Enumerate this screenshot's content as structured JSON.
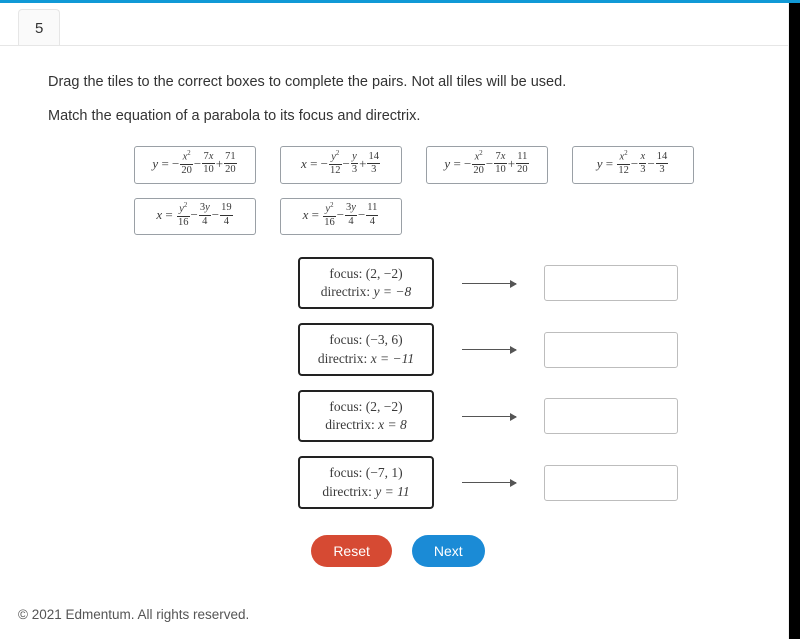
{
  "tab": {
    "label": "5"
  },
  "instruction": "Drag the tiles to the correct boxes to complete the pairs. Not all tiles will be used.",
  "subinstruction": "Match the equation of a parabola to its focus and directrix.",
  "tiles": {
    "t1": {
      "lhs_var": "y",
      "terms": [
        "−",
        "x²",
        "20",
        "−",
        "7x",
        "10",
        "+",
        "71",
        "20"
      ]
    },
    "t2": {
      "lhs_var": "x",
      "terms": [
        "−",
        "y²",
        "12",
        "−",
        "y",
        "3",
        "+",
        "14",
        "3"
      ]
    },
    "t3": {
      "lhs_var": "y",
      "terms": [
        "−",
        "x²",
        "20",
        "−",
        "7x",
        "10",
        "+",
        "11",
        "20"
      ]
    },
    "t4": {
      "lhs_var": "y",
      "terms": [
        "",
        "x²",
        "12",
        "−",
        "x",
        "3",
        "−",
        "14",
        "3"
      ]
    },
    "t5": {
      "lhs_var": "x",
      "terms": [
        "",
        "y²",
        "16",
        "−",
        "3y",
        "4",
        "−",
        "19",
        "4"
      ]
    },
    "t6": {
      "lhs_var": "x",
      "terms": [
        "",
        "y²",
        "16",
        "−",
        "3y",
        "4",
        "−",
        "11",
        "4"
      ]
    }
  },
  "pairs": [
    {
      "focus_label": "focus:",
      "focus": "(2, −2)",
      "directrix_label": "directrix:",
      "directrix": "y = −8"
    },
    {
      "focus_label": "focus:",
      "focus": "(−3, 6)",
      "directrix_label": "directrix:",
      "directrix": "x = −11"
    },
    {
      "focus_label": "focus:",
      "focus": "(2, −2)",
      "directrix_label": "directrix:",
      "directrix": "x = 8"
    },
    {
      "focus_label": "focus:",
      "focus": "(−7, 1)",
      "directrix_label": "directrix:",
      "directrix": "y = 11"
    }
  ],
  "buttons": {
    "reset": "Reset",
    "next": "Next"
  },
  "footer": "© 2021 Edmentum. All rights reserved."
}
